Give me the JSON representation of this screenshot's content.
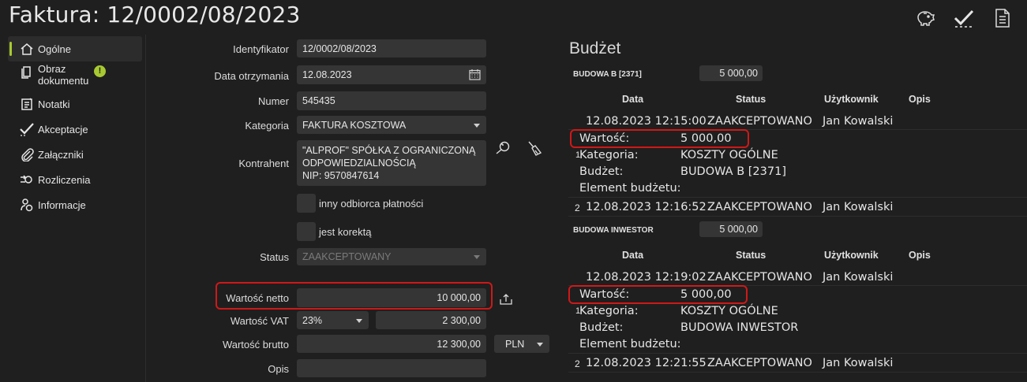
{
  "window": {
    "title": "Faktura: 12/0002/08/2023"
  },
  "top_icons": [
    "piggy-bank-icon",
    "checkmark-icon",
    "document-icon"
  ],
  "sidebar": {
    "items": [
      {
        "label": "Ogólne",
        "icon": "home-icon",
        "active": true
      },
      {
        "label": "Obraz\ndokumentu",
        "icon": "document-image-icon",
        "badge": "!"
      },
      {
        "label": "Notatki",
        "icon": "notes-icon"
      },
      {
        "label": "Akceptacje",
        "icon": "checkmark-icon"
      },
      {
        "label": "Załączniki",
        "icon": "paperclip-icon"
      },
      {
        "label": "Rozliczenia",
        "icon": "settlement-icon"
      },
      {
        "label": "Informacje",
        "icon": "user-info-icon"
      }
    ]
  },
  "form": {
    "identyfikator": {
      "label": "Identyfikator",
      "value": "12/0002/08/2023"
    },
    "data_otrzymania": {
      "label": "Data otrzymania",
      "value": "12.08.2023"
    },
    "numer": {
      "label": "Numer",
      "value": "545435"
    },
    "kategoria": {
      "label": "Kategoria",
      "value": "FAKTURA KOSZTOWA"
    },
    "kontrahent": {
      "label": "Kontrahent",
      "line1": "\"ALPROF\" SPÓŁKA Z OGRANICZONĄ",
      "line2": "ODPOWIEDZIALNOŚCIĄ",
      "line3": "NIP: 9570847614"
    },
    "inny_odbiorca": {
      "label": "inny odbiorca płatności"
    },
    "jest_korekta": {
      "label": "jest korektą"
    },
    "status": {
      "label": "Status",
      "value": "ZAAKCEPTOWANY"
    },
    "wartosc_netto": {
      "label": "Wartość netto",
      "value": "10 000,00"
    },
    "wartosc_vat": {
      "label": "Wartość VAT",
      "rate": "23%",
      "value": "2 300,00"
    },
    "wartosc_brutto": {
      "label": "Wartość brutto",
      "value": "12 300,00",
      "currency": "PLN"
    },
    "opis": {
      "label": "Opis",
      "value": ""
    }
  },
  "budget": {
    "title": "Budżet",
    "headers": {
      "data": "Data",
      "status": "Status",
      "user": "Użytkownik",
      "opis": "Opis"
    },
    "sections": [
      {
        "name": "BUDOWA B [2371]",
        "amount": "5 000,00",
        "row1": {
          "date": "12.08.2023 12:15:00",
          "status": "ZAAKCEPTOWANO",
          "user": "Jan Kowalski"
        },
        "detail": {
          "num": "1",
          "wartosc_label": "Wartość:",
          "wartosc": "5 000,00",
          "kategoria_label": "Kategoria:",
          "kategoria": "KOSZTY OGÓLNE",
          "budzet_label": "Budżet:",
          "budzet": "BUDOWA B [2371]",
          "element_label": "Element budżetu:"
        },
        "row2": {
          "num": "2",
          "date": "12.08.2023 12:16:52",
          "status": "ZAAKCEPTOWANO",
          "user": "Jan Kowalski"
        }
      },
      {
        "name": "BUDOWA INWESTOR",
        "amount": "5 000,00",
        "row1": {
          "date": "12.08.2023 12:19:02",
          "status": "ZAAKCEPTOWANO",
          "user": "Jan Kowalski"
        },
        "detail": {
          "num": "1",
          "wartosc_label": "Wartość:",
          "wartosc": "5 000,00",
          "kategoria_label": "Kategoria:",
          "kategoria": "KOSZTY OGÓLNE",
          "budzet_label": "Budżet:",
          "budzet": "BUDOWA INWESTOR",
          "element_label": "Element budżetu:"
        },
        "row2": {
          "num": "2",
          "date": "12.08.2023 12:21:55",
          "status": "ZAAKCEPTOWANO",
          "user": "Jan Kowalski"
        }
      }
    ]
  },
  "colors": {
    "accent": "#a8c931",
    "highlight_border": "#d01818",
    "background": "#1f1f1f",
    "field": "#353535"
  }
}
